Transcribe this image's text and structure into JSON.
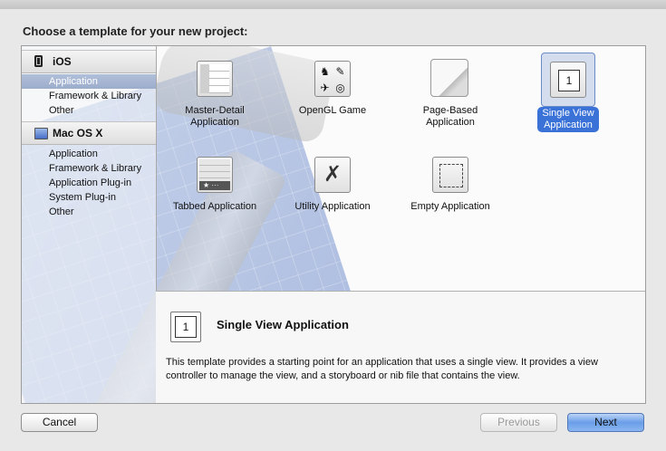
{
  "dialog": {
    "title": "Choose a template for your new project:"
  },
  "sidebar": {
    "sections": [
      {
        "label": "iOS",
        "icon": "iphone-icon",
        "items": [
          "Application",
          "Framework & Library",
          "Other"
        ],
        "selected": "Application"
      },
      {
        "label": "Mac OS X",
        "icon": "mac-icon",
        "items": [
          "Application",
          "Framework & Library",
          "Application Plug-in",
          "System Plug-in",
          "Other"
        ]
      }
    ]
  },
  "templates": [
    {
      "label": "Master-Detail\nApplication",
      "icon": "master-detail-icon"
    },
    {
      "label": "OpenGL Game",
      "icon": "opengl-game-icon"
    },
    {
      "label": "Page-Based\nApplication",
      "icon": "page-based-icon"
    },
    {
      "label": "Single View\nApplication",
      "icon": "single-view-icon",
      "icon_text": "1",
      "selected": true
    },
    {
      "label": "Tabbed Application",
      "icon": "tabbed-icon"
    },
    {
      "label": "Utility Application",
      "icon": "utility-icon"
    },
    {
      "label": "Empty Application",
      "icon": "empty-icon"
    }
  ],
  "description": {
    "icon_text": "1",
    "title": "Single View Application",
    "text": "This template provides a starting point for an application that uses a single view. It provides a view controller to manage the view, and a storyboard or nib file that contains the view."
  },
  "buttons": {
    "cancel": "Cancel",
    "previous": "Previous",
    "next": "Next"
  },
  "colors": {
    "selection_blue": "#3b72d7",
    "sidebar_selected": "#a5b5d3"
  }
}
